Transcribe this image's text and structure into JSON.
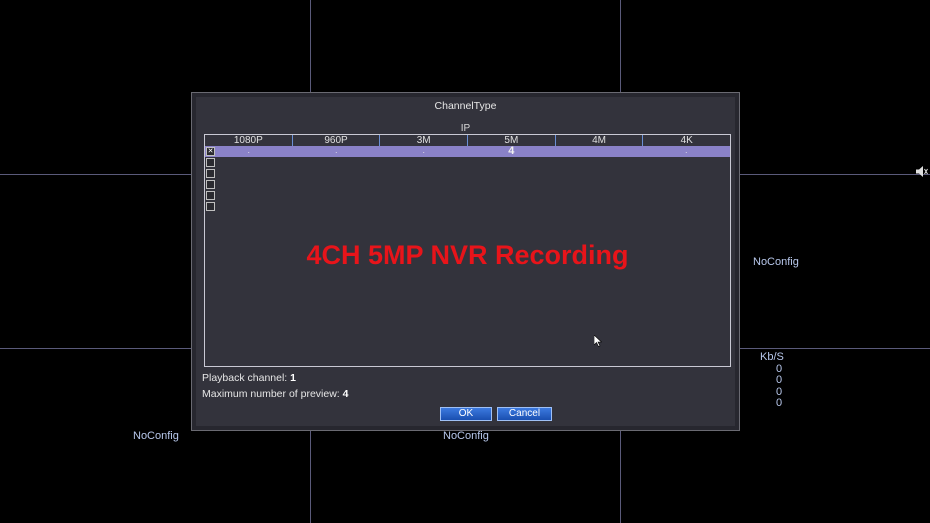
{
  "tiles": {
    "noconfig_label": "NoConfig"
  },
  "bitrate": {
    "header": "Kb/S",
    "values": [
      "0",
      "0",
      "0",
      "0"
    ]
  },
  "dialog": {
    "title": "ChannelType",
    "section_label": "IP",
    "columns": [
      "1080P",
      "960P",
      "3M",
      "5M",
      "4M",
      "4K"
    ],
    "rows": [
      {
        "checked": true,
        "checkmark": "✕",
        "cells": [
          ".",
          ".",
          ".",
          "4",
          "",
          "."
        ]
      },
      {
        "checked": false,
        "checkmark": "",
        "cells": [
          "",
          "",
          "",
          "",
          "",
          ""
        ]
      },
      {
        "checked": false,
        "checkmark": "",
        "cells": [
          "",
          "",
          "",
          "",
          "",
          ""
        ]
      },
      {
        "checked": false,
        "checkmark": "",
        "cells": [
          "",
          "",
          "",
          "",
          "",
          ""
        ]
      },
      {
        "checked": false,
        "checkmark": "",
        "cells": [
          "",
          "",
          "",
          "",
          "",
          ""
        ]
      },
      {
        "checked": false,
        "checkmark": "",
        "cells": [
          "",
          "",
          "",
          "",
          "",
          ""
        ]
      }
    ],
    "overlay_text": "4CH 5MP NVR Recording",
    "playback_label": "Playback channel:",
    "playback_value": "1",
    "preview_label": "Maximum number of preview:",
    "preview_value": "4",
    "ok_label": "OK",
    "cancel_label": "Cancel"
  }
}
